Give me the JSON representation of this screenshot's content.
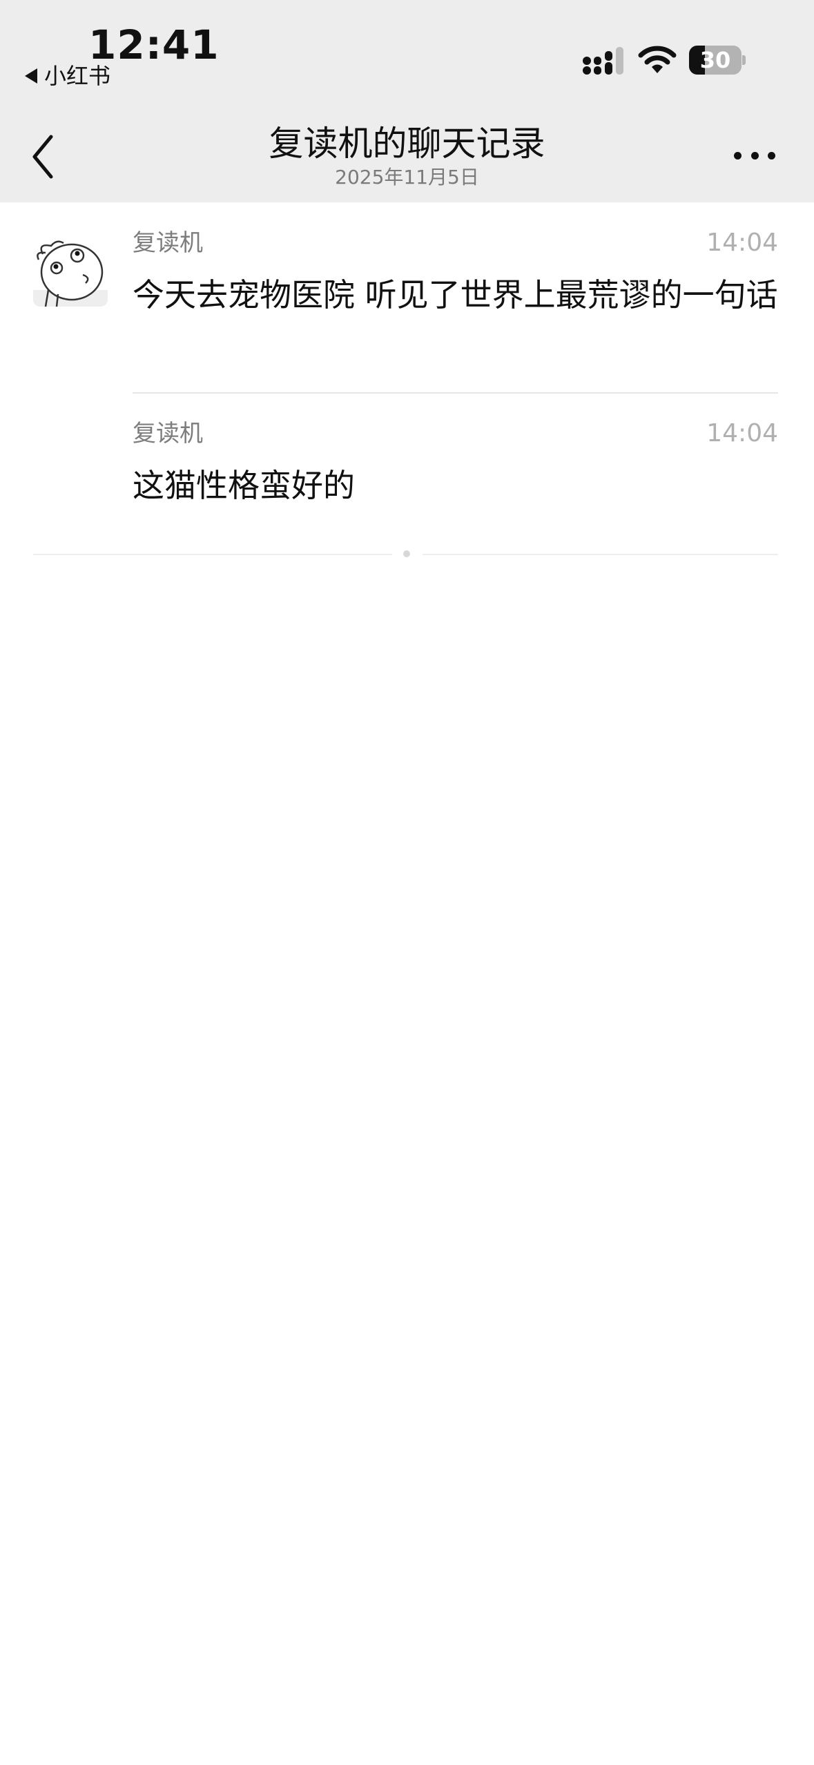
{
  "status_bar": {
    "time": "12:41",
    "back_app": "小红书",
    "battery_level": "30",
    "battery_fraction": 0.3,
    "signal_bars_active": 3,
    "signal_bars_total": 4
  },
  "nav": {
    "title": "复读机的聊天记录",
    "subtitle": "2025年11月5日",
    "back_icon": "chevron-left-icon",
    "more_icon": "more-icon"
  },
  "messages": [
    {
      "sender": "复读机",
      "time": "14:04",
      "text": "今天去宠物医院 听见了世界上最荒谬的一句话"
    },
    {
      "sender": "复读机",
      "time": "14:04",
      "text": "这猫性格蛮好的"
    }
  ]
}
